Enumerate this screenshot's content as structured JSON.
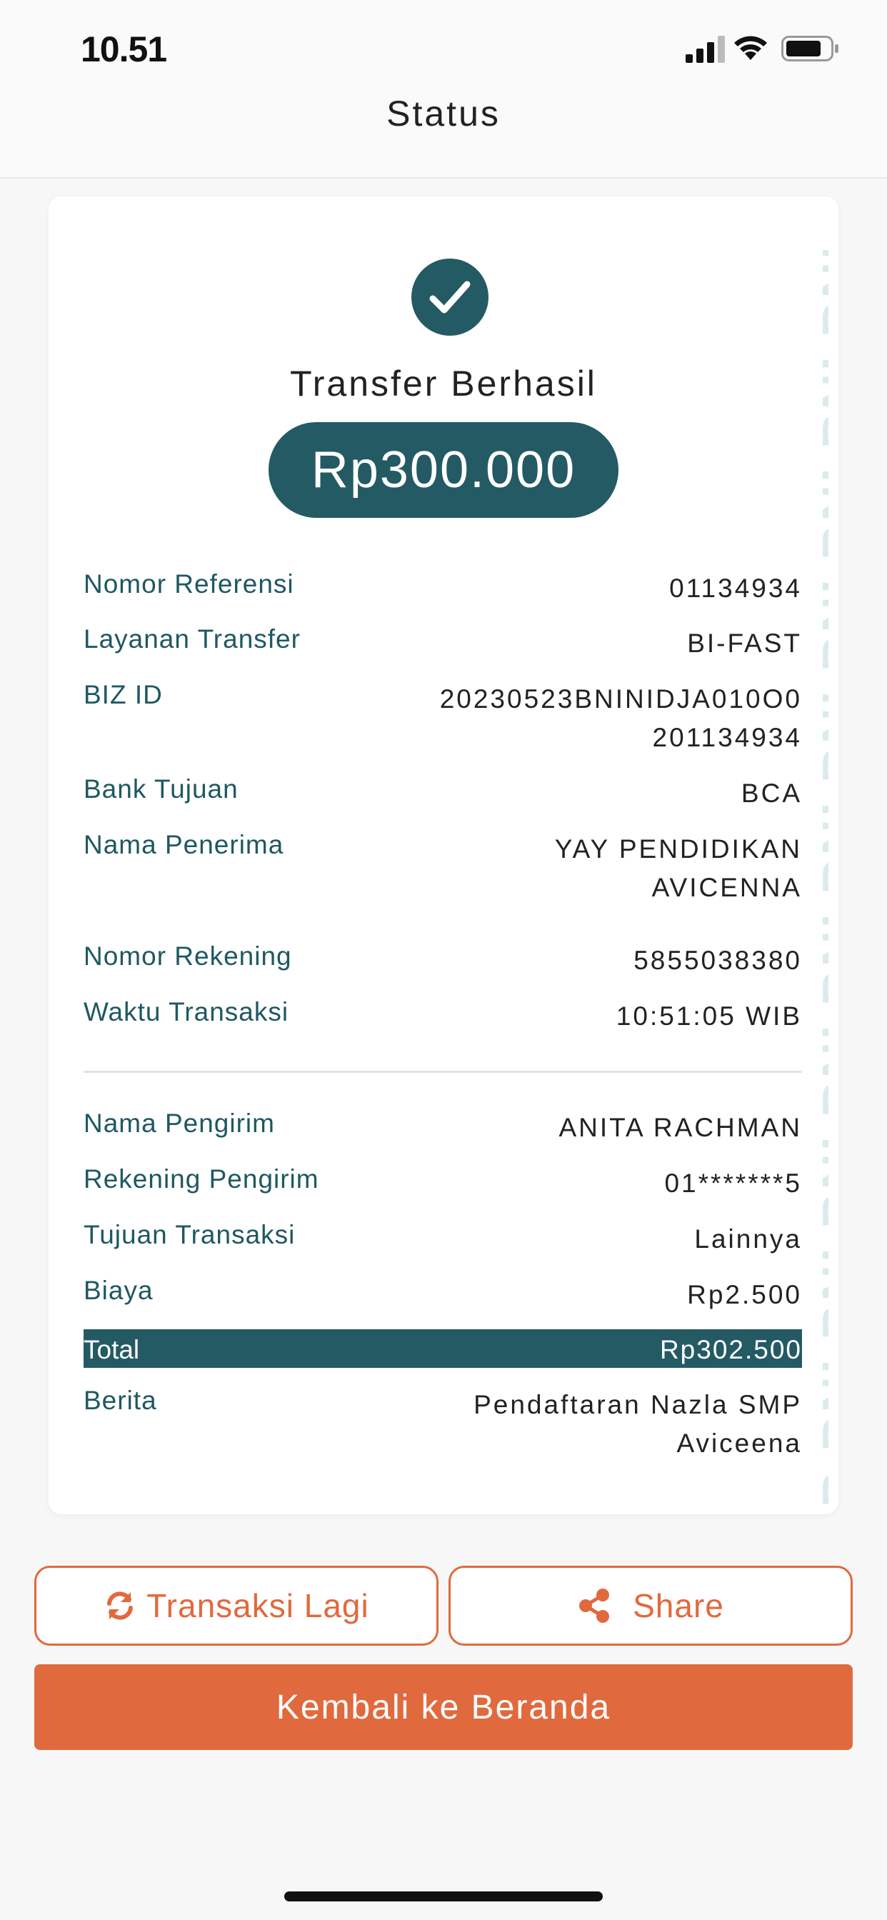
{
  "status_bar": {
    "time": "10.51"
  },
  "nav": {
    "title": "Status"
  },
  "receipt": {
    "status_title": "Transfer Berhasil",
    "amount": "Rp300.000",
    "watermark_text": "B BNI BNI BNI BNI BNI BNI BNI BNI BNI BNI BNI",
    "details": [
      {
        "label": "Nomor Referensi",
        "value": "01134934"
      },
      {
        "label": "Layanan Transfer",
        "value": "BI-FAST"
      },
      {
        "label": "BIZ ID",
        "value": "20230523BNINIDJA010O0 201134934"
      },
      {
        "label": "Bank Tujuan",
        "value": "BCA"
      },
      {
        "label": "Nama Penerima",
        "value": "YAY PENDIDIKAN AVICENNA"
      },
      {
        "label": "Nomor Rekening",
        "value": "5855038380"
      },
      {
        "label": "Waktu Transaksi",
        "value": "10:51:05 WIB"
      }
    ],
    "sender": [
      {
        "label": "Nama Pengirim",
        "value": "ANITA RACHMAN"
      },
      {
        "label": "Rekening Pengirim",
        "value": "01*******5"
      },
      {
        "label": "Tujuan Transaksi",
        "value": "Lainnya"
      },
      {
        "label": "Biaya",
        "value": "Rp2.500"
      }
    ],
    "total": {
      "label": "Total",
      "value": "Rp302.500"
    },
    "note": {
      "label": "Berita",
      "value": "Pendaftaran Nazla SMP Aviceena"
    }
  },
  "actions": {
    "repeat_label": "Transaksi Lagi",
    "share_label": "Share",
    "home_label": "Kembali ke Beranda"
  },
  "colors": {
    "primary": "#245a64",
    "accent": "#e06a3e"
  },
  "icons": [
    "signal-icon",
    "wifi-icon",
    "battery-icon",
    "checkmark-icon",
    "refresh-icon",
    "share-icon"
  ]
}
